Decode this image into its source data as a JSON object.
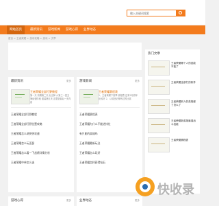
{
  "search": {
    "placeholder": "输入关键词搜索"
  },
  "nav": {
    "items": [
      {
        "label": "网站首页"
      },
      {
        "label": "最新资讯"
      },
      {
        "label": "游戏新闻"
      },
      {
        "label": "游戏心得"
      },
      {
        "label": "业界动态"
      }
    ]
  },
  "breadcrumb": "首页 > 王者荣耀 > 游戏攻略 > 游戏 > 文章",
  "latest": {
    "title": "最新资讯",
    "more": "更多",
    "featured": {
      "title": "王者荣耀全部打野教程",
      "desc": "第一天 前期第二天 后当掉 从第三一四五第经营阶段 套装第五天 这里是最后一天内容"
    },
    "items": [
      "王者荣耀全部打野教程",
      "王者荣耀全部打野位置攻略",
      "王者荣耀怎么调突突攻速",
      "王者荣耀怎么玩亚瑟",
      "王者荣耀怎么看一下战绩详情分析",
      "王者荣耀中单怎么选"
    ]
  },
  "game_news": {
    "title": "游戏新闻",
    "more": "更多",
    "featured": {
      "title": "王者荣耀赛程表",
      "desc": "1、王者荣耀下赛季 赛程表 还有2月赛年比较好 2、以前还记得有过的比赛"
    },
    "items": [
      "王者荣耀赛程表",
      "王者荣耀为什么不能进排位",
      "有只能的英雄吗",
      "王者荣耀最新玩法",
      "王者荣耀怎么玩好",
      "王者荣耀怎样获得钻石"
    ]
  },
  "hot": {
    "title": "热门文章",
    "items": [
      "王者荣耀哪个人的技能不能了",
      "王者荣耀全部打的软件",
      "王者荣耀别人的英雄都了怎么了",
      "王者荣耀新英雄最强战斗技能",
      "王者荣耀赛程表"
    ]
  },
  "bottom": {
    "left_title": "游戏心得",
    "left_more": "更多",
    "right_title": "业界动态",
    "right_more": "更多"
  },
  "watermark": {
    "text": "快收录"
  }
}
